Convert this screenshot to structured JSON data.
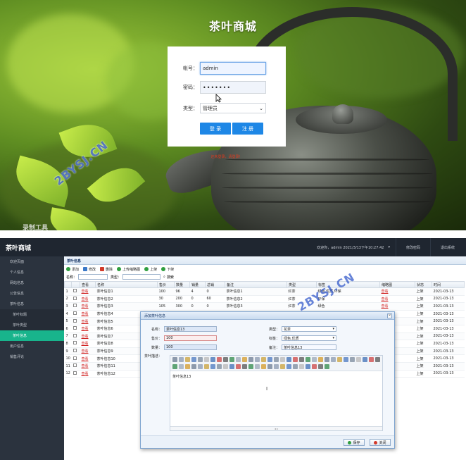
{
  "login": {
    "title": "茶叶商城",
    "username_label": "帐号：",
    "username_value": "admin",
    "password_label": "密码：",
    "password_value": "•••••••",
    "type_label": "类型：",
    "type_value": "管理员",
    "login_button": "登 录",
    "register_button": "注 册",
    "error_text": "还未登录，请登录！",
    "watermark": "2BYSJ.CN",
    "recorder_mark": "录制工具"
  },
  "admin": {
    "app_title": "茶叶商城",
    "topbar": {
      "welcome": "欢迎你，admin  2021/3/13下午10:27:42",
      "change_password": "修改密码",
      "logout": "退出系统"
    },
    "sidebar": [
      {
        "label": "欢迎页面",
        "type": "item"
      },
      {
        "label": "个人信息",
        "type": "item"
      },
      {
        "label": "网站信息",
        "type": "item"
      },
      {
        "label": "公告信息",
        "type": "item"
      },
      {
        "label": "茶叶信息",
        "type": "item"
      },
      {
        "label": "茶叶标题",
        "type": "sub"
      },
      {
        "label": "茶叶类型",
        "type": "sub"
      },
      {
        "label": "茶叶信息",
        "type": "sub-active"
      },
      {
        "label": "用户信息",
        "type": "item"
      },
      {
        "label": "销售评论",
        "type": "item"
      }
    ],
    "panel_title": "茶叶信息",
    "toolbar": [
      {
        "label": "添加",
        "color": "#2f9e3f"
      },
      {
        "label": "修改",
        "color": "#3a78c8"
      },
      {
        "label": "删除",
        "color": "#d23a2a"
      },
      {
        "label": "上传缩略图",
        "color": "#2f9e3f"
      },
      {
        "label": "上架",
        "color": "#2f9e3f"
      },
      {
        "label": "下架",
        "color": "#2f9e3f"
      }
    ],
    "search": {
      "name_label": "名称：",
      "type_label": "类型：",
      "search_button": "搜索"
    },
    "columns": [
      "",
      "",
      "查看",
      "名称",
      "售价",
      "数量",
      "销量",
      "总销",
      "备注",
      "类型",
      "标签",
      "缩略图",
      "状态",
      "时间"
    ],
    "rows": [
      {
        "n": "1",
        "view": "查看",
        "name": "茶叶信息1",
        "price": "100",
        "qty": "96",
        "sold": "4",
        "total": "0",
        "note": "茶叶信息1",
        "type": "红茶",
        "tags": "绿色,优质,环保",
        "thumb": "查看",
        "status": "上架",
        "time": "2021-03-13"
      },
      {
        "n": "2",
        "view": "查看",
        "name": "茶叶信息2",
        "price": "30",
        "qty": "200",
        "sold": "0",
        "total": "60",
        "note": "茶叶信息2",
        "type": "红茶",
        "tags": "环保",
        "thumb": "查看",
        "status": "上架",
        "time": "2021-03-13"
      },
      {
        "n": "3",
        "view": "查看",
        "name": "茶叶信息3",
        "price": "105",
        "qty": "300",
        "sold": "0",
        "total": "0",
        "note": "茶叶信息3",
        "type": "红茶",
        "tags": "绿色",
        "thumb": "查看",
        "status": "上架",
        "time": "2021-03-13"
      },
      {
        "n": "4",
        "view": "查看",
        "name": "茶叶信息4",
        "price": "",
        "qty": "",
        "sold": "",
        "total": "",
        "note": "",
        "type": "",
        "tags": "",
        "thumb": "查看",
        "status": "上架",
        "time": "2021-03-13"
      },
      {
        "n": "5",
        "view": "查看",
        "name": "茶叶信息5",
        "price": "",
        "qty": "",
        "sold": "",
        "total": "",
        "note": "",
        "type": "",
        "tags": "",
        "thumb": "查看",
        "status": "上架",
        "time": "2021-03-13"
      },
      {
        "n": "6",
        "view": "查看",
        "name": "茶叶信息6",
        "price": "",
        "qty": "",
        "sold": "",
        "total": "",
        "note": "",
        "type": "",
        "tags": "",
        "thumb": "查看",
        "status": "上架",
        "time": "2021-03-13"
      },
      {
        "n": "7",
        "view": "查看",
        "name": "茶叶信息7",
        "price": "",
        "qty": "",
        "sold": "",
        "total": "",
        "note": "",
        "type": "",
        "tags": "",
        "thumb": "查看",
        "status": "上架",
        "time": "2021-03-13"
      },
      {
        "n": "8",
        "view": "查看",
        "name": "茶叶信息8",
        "price": "",
        "qty": "",
        "sold": "",
        "total": "",
        "note": "",
        "type": "",
        "tags": "",
        "thumb": "查看",
        "status": "上架",
        "time": "2021-03-13"
      },
      {
        "n": "9",
        "view": "查看",
        "name": "茶叶信息9",
        "price": "",
        "qty": "",
        "sold": "",
        "total": "",
        "note": "",
        "type": "",
        "tags": "",
        "thumb": "查看",
        "status": "上架",
        "time": "2021-03-13"
      },
      {
        "n": "10",
        "view": "查看",
        "name": "茶叶信息10",
        "price": "",
        "qty": "",
        "sold": "",
        "total": "",
        "note": "",
        "type": "",
        "tags": "",
        "thumb": "查看",
        "status": "上架",
        "time": "2021-03-13"
      },
      {
        "n": "11",
        "view": "查看",
        "name": "茶叶信息11",
        "price": "",
        "qty": "",
        "sold": "",
        "total": "",
        "note": "",
        "type": "",
        "tags": "",
        "thumb": "查看",
        "status": "上架",
        "time": "2021-03-13"
      },
      {
        "n": "12",
        "view": "查看",
        "name": "茶叶信息12",
        "price": "",
        "qty": "",
        "sold": "",
        "total": "",
        "note": "",
        "type": "",
        "tags": "",
        "thumb": "查看",
        "status": "上架",
        "time": "2021-03-13"
      }
    ],
    "dialog": {
      "title": "添加茶叶信息",
      "name_label": "名称：",
      "name_value": "茶叶信息13",
      "price_label": "售价：",
      "price_value": "100",
      "qty_label": "数量：",
      "qty_value": "100",
      "desc_label": "茶叶描述：",
      "type_label": "类型：",
      "type_value": "花茶",
      "tag_label": "标签：",
      "tag_value": "绿色,优质",
      "note_label": "备注：",
      "note_value": "茶叶信息13",
      "editor_text": "茶叶信息13",
      "save_button": "保存",
      "close_button": "关闭"
    },
    "watermark": "2BYSJ.CN"
  }
}
